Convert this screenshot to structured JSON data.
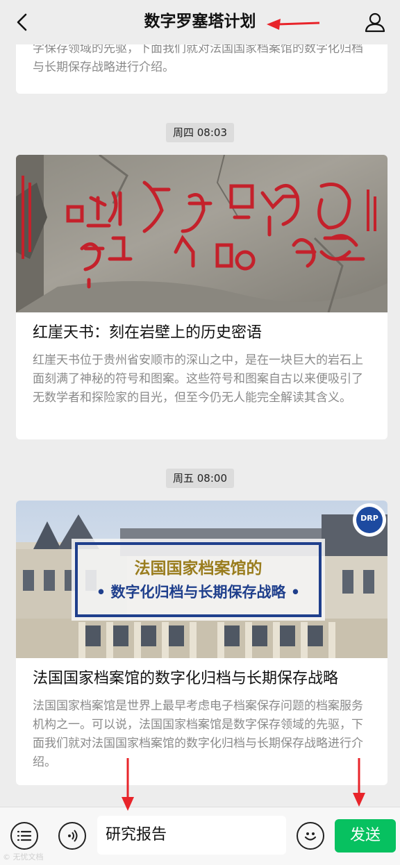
{
  "header": {
    "title": "数字罗塞塔计划",
    "back_icon": "chevron-left-icon",
    "profile_icon": "person-icon"
  },
  "articles": [
    {
      "digest": "字保存领域的先驱，下面我们就对法国国家档案馆的数字化归档与长期保存战略进行介绍。"
    },
    {
      "timestamp": "周四 08:03",
      "title": "红崖天书：刻在岩壁上的历史密语",
      "digest": "红崖天书位于贵州省安顺市的深山之中，是在一块巨大的岩石上面刻满了神秘的符号和图案。这些符号和图案自古以来便吸引了无数学者和探险家的目光，但至今仍无人能完全解读其含义。"
    },
    {
      "timestamp": "周五 08:00",
      "cover_line1": "法国国家档案馆的",
      "cover_line2": "• 数字化归档与长期保存战略 •",
      "cover_badge": "DRP",
      "title": "法国国家档案馆的数字化归档与长期保存战略",
      "digest": "法国国家档案馆是世界上最早考虑电子档案保存问题的档案服务机构之一。可以说，法国国家档案馆是数字保存领域的先驱，下面我们就对法国国家档案馆的数字化归档与长期保存战略进行介绍。"
    }
  ],
  "bottom_bar": {
    "menu_icon": "menu-icon",
    "voice_icon": "voice-icon",
    "input_value": "研究报告",
    "emoji_icon": "emoji-icon",
    "send_label": "发送"
  },
  "colors": {
    "send_green": "#07c160",
    "arrow_red": "#e8242a",
    "background": "#ededed"
  },
  "watermark": "© 无忧文档"
}
